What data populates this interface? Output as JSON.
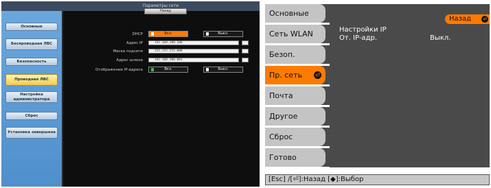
{
  "left": {
    "title": "Параметры сети",
    "back_label": "Назад",
    "sidebar": [
      "Основные",
      "Беспроводная ЛВС",
      "Безопасность",
      "Проводная ЛВС",
      "Настройка администратора",
      "Сброс",
      "Установка завершена"
    ],
    "active_sidebar_index": 3,
    "dhcp": {
      "label": "DHCP",
      "on": "Вкл.",
      "off": "Выкл."
    },
    "fields": [
      {
        "label": "Адрес IP",
        "value": "192.168.100.100"
      },
      {
        "label": "Маска подсети",
        "value": "255.255.255.000"
      },
      {
        "label": "Адрес шлюза",
        "value": "192.168.100.001"
      }
    ],
    "ip_display": {
      "label": "Отображение IP-адреса",
      "on": "Вкл.",
      "off": "Выкл."
    }
  },
  "right": {
    "menu": [
      "Основные",
      "Сеть WLAN",
      "Безоп.",
      "Пр. сеть",
      "Почта",
      "Другое",
      "Сброс",
      "Готово"
    ],
    "active_menu_index": 3,
    "back_label": "Назад",
    "ip_settings_label": "Настройки IP",
    "ip_display_label": "От. IP-адр.",
    "ip_display_value": "Выкл.",
    "status_bar": "[Esc] /[⏎]:Назад [◆]:Выбор"
  },
  "colors": {
    "accent": "#ff7a00",
    "menu_bg": "#c4c4c4",
    "panel_bg": "#4a4a4a"
  }
}
